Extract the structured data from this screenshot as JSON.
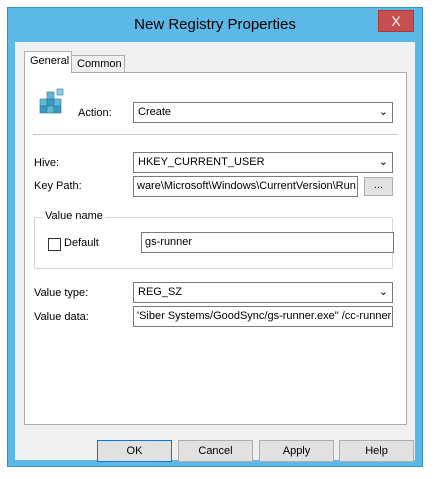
{
  "window": {
    "title": "New Registry Properties",
    "close_label": "X"
  },
  "tabs": [
    {
      "label": "General"
    },
    {
      "label": "Common"
    }
  ],
  "general": {
    "action_label": "Action:",
    "action_value": "Create",
    "hive_label": "Hive:",
    "hive_value": "HKEY_CURRENT_USER",
    "keypath_label": "Key Path:",
    "keypath_value": "ware\\Microsoft\\Windows\\CurrentVersion\\Run",
    "browse_label": "...",
    "valuename_group": "Value name",
    "default_label": "Default",
    "default_checked": false,
    "valuename_value": "gs-runner",
    "valuetype_label": "Value type:",
    "valuetype_value": "REG_SZ",
    "valuedata_label": "Value data:",
    "valuedata_value": "'Siber Systems/GoodSync/gs-runner.exe\" /cc-runner"
  },
  "buttons": {
    "ok": "OK",
    "cancel": "Cancel",
    "apply": "Apply",
    "help": "Help"
  },
  "icons": {
    "registry": "registry-cubes-icon",
    "dropdown": "chevron-down-icon"
  },
  "colors": {
    "titlebar": "#5cb8e6",
    "close": "#c7504e",
    "focus": "#0078d7"
  }
}
